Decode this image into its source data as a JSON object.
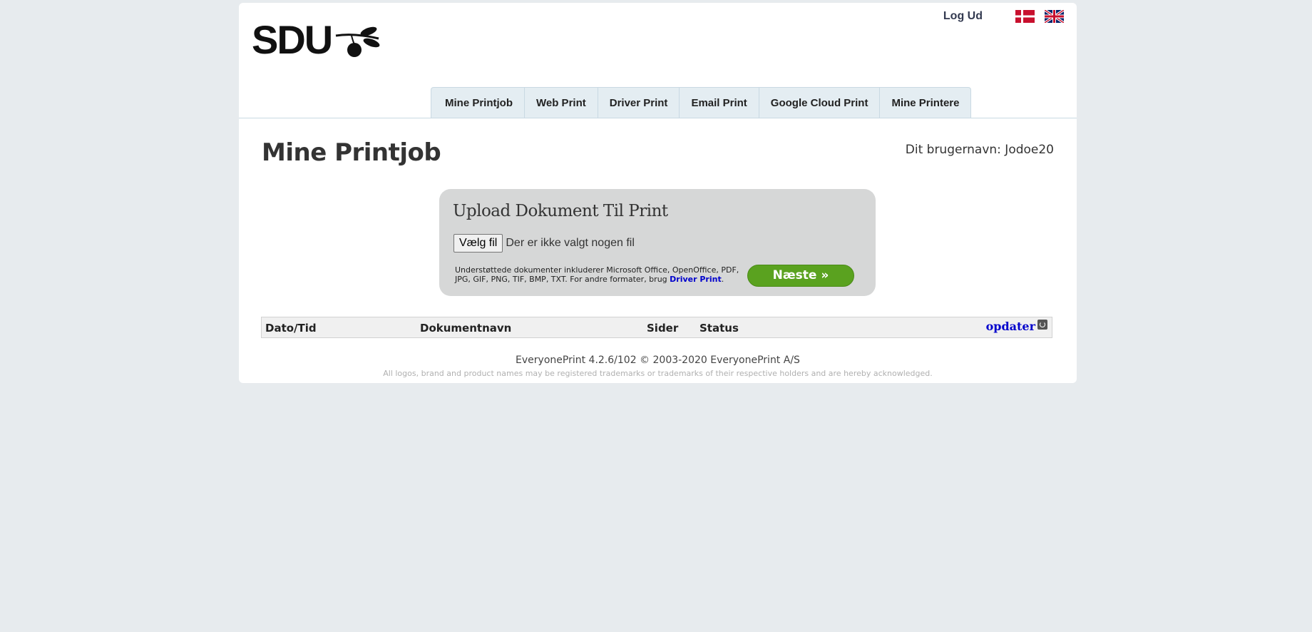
{
  "header": {
    "logo_text": "SDU",
    "logout_label": "Log Ud",
    "languages": [
      "dansk-flag-icon",
      "english-flag-icon"
    ]
  },
  "tabs": [
    {
      "label": "Mine Printjob"
    },
    {
      "label": "Web Print"
    },
    {
      "label": "Driver Print"
    },
    {
      "label": "Email Print"
    },
    {
      "label": "Google Cloud Print"
    },
    {
      "label": "Mine Printere"
    }
  ],
  "main": {
    "title": "Mine Printjob",
    "username_label": "Dit brugernavn: Jodoe20"
  },
  "upload": {
    "title": "Upload Dokument Til Print",
    "choose_file_label": "Vælg fil",
    "file_status": "Der er ikke valgt nogen fil",
    "supported_text": "Understøttede dokumenter inkluderer Microsoft Office, OpenOffice, PDF, JPG, GIF, PNG, TIF, BMP, TXT. For andre formater, brug ",
    "driver_print_link": "Driver Print",
    "supported_suffix": ".",
    "next_label": "Næste »"
  },
  "table": {
    "columns": [
      "Dato/Tid",
      "Dokumentnavn",
      "Sider",
      "Status"
    ],
    "refresh_label": "opdater"
  },
  "footer": {
    "main": "EveryonePrint 4.2.6/102 © 2003-2020 EveryonePrint A/S",
    "small": "All logos, brand and product names may be registered trademarks or trademarks of their respective holders and are hereby acknowledged."
  },
  "colors": {
    "background": "#e7ebee",
    "tab_bg": "#e4edf2",
    "next_button": "#5aa21f",
    "link": "#0000cc"
  }
}
